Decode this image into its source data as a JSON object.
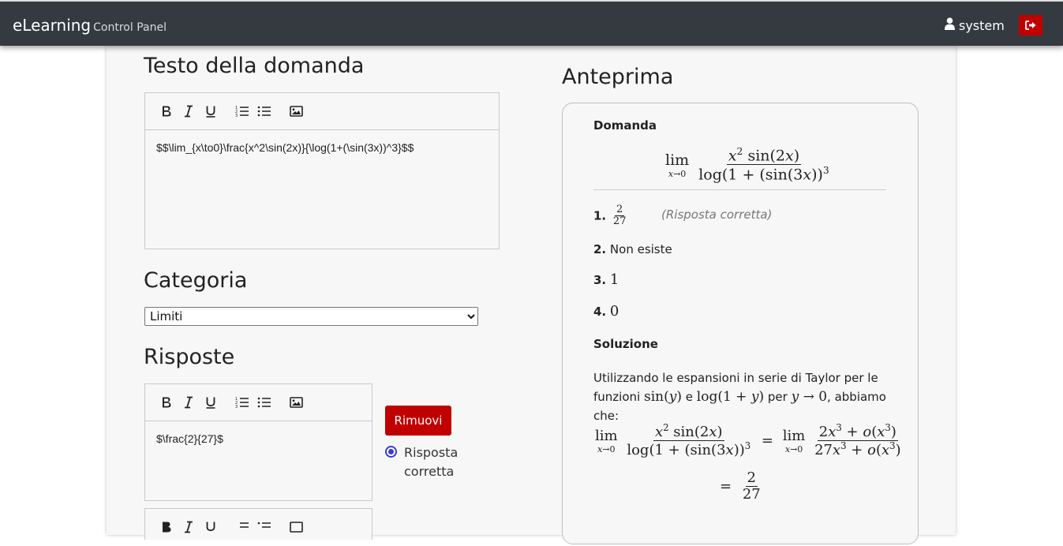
{
  "navbar": {
    "brand": "eLearning",
    "brand_sub": "Control Panel",
    "user": "system"
  },
  "question": {
    "title": "Testo della domanda",
    "text": "$$\\lim_{x\\to0}\\frac{x^2\\sin(2x)}{\\log(1+(\\sin(3x))^3}$$"
  },
  "category": {
    "title": "Categoria",
    "selected": "Limiti"
  },
  "answers": {
    "title": "Risposte",
    "items": [
      {
        "text": "$\\frac{2}{27}$",
        "remove_label": "Rimuovi",
        "correct_label": "Risposta corretta"
      }
    ]
  },
  "preview": {
    "title": "Anteprima",
    "question_label": "Domanda",
    "options": [
      {
        "num": "1.",
        "num_value": "2",
        "den_value": "27",
        "note": "(Risposta corretta)"
      },
      {
        "num": "2.",
        "text": "Non esiste"
      },
      {
        "num": "3.",
        "text": "1"
      },
      {
        "num": "4.",
        "text": "0"
      }
    ],
    "solution_label": "Soluzione",
    "solution_text_1": "Utilizzando le espansioni in serie di Taylor per le",
    "solution_text_2_a": "funzioni",
    "solution_text_2_b": "e",
    "solution_text_2_c": "per",
    "solution_text_2_d": ", abbiamo",
    "solution_text_3": "che:"
  }
}
